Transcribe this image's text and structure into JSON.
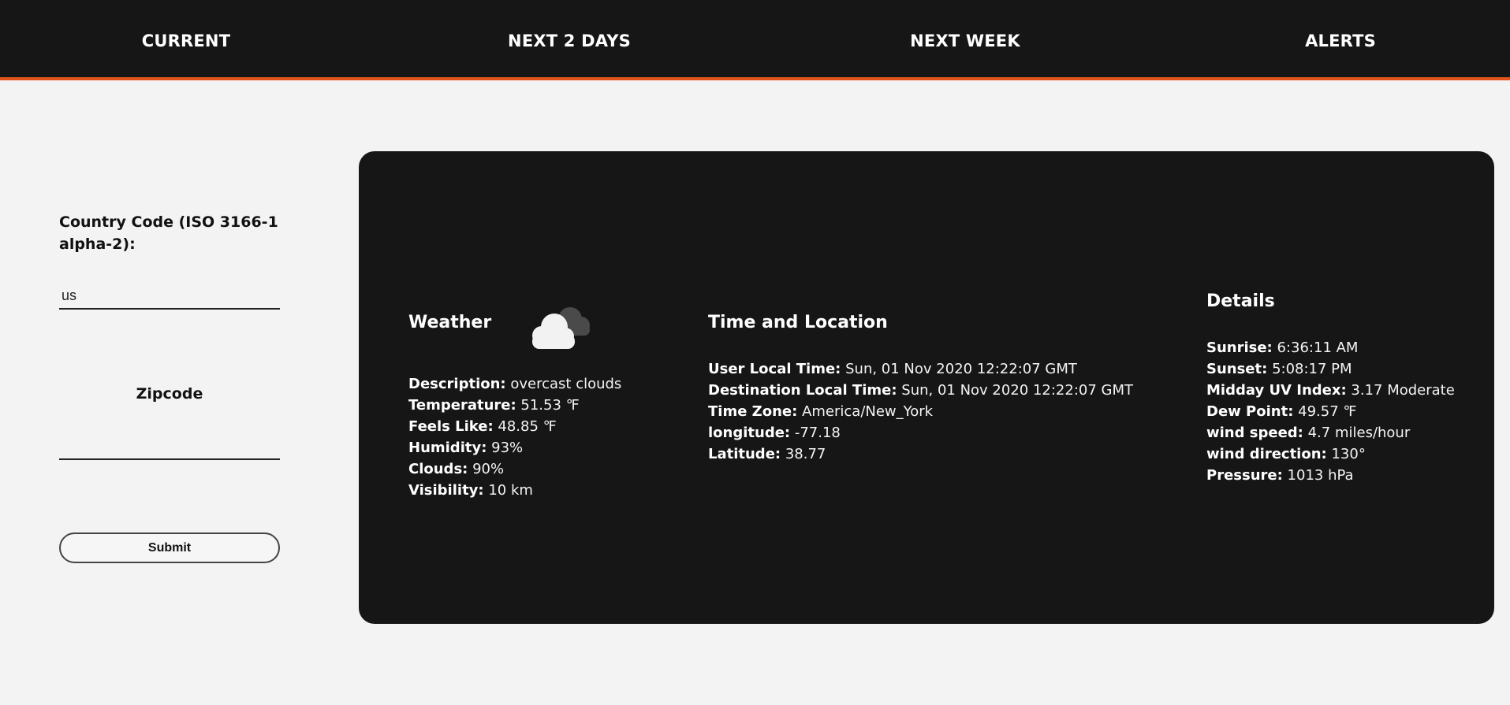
{
  "nav": {
    "tabs": [
      "CURRENT",
      "NEXT 2 DAYS",
      "NEXT WEEK",
      "ALERTS"
    ]
  },
  "colors": {
    "nav_bg": "#161616",
    "accent": "#e2531c",
    "page_bg": "#f3f3f3",
    "card_bg": "#161616"
  },
  "form": {
    "country_label": "Country Code (ISO 3166-1 alpha-2):",
    "country_value": "us",
    "zip_label": "Zipcode",
    "zip_value": "",
    "submit_label": "Submit"
  },
  "weather": {
    "title": "Weather",
    "icon": "overcast-clouds-icon",
    "rows": [
      {
        "label": "Description:",
        "value": "overcast clouds"
      },
      {
        "label": "Temperature:",
        "value": "51.53 ℉"
      },
      {
        "label": "Feels Like:",
        "value": "48.85 ℉"
      },
      {
        "label": "Humidity:",
        "value": "93%"
      },
      {
        "label": "Clouds:",
        "value": "90%"
      },
      {
        "label": "Visibility:",
        "value": "10 km"
      }
    ]
  },
  "time_location": {
    "title": "Time and Location",
    "rows": [
      {
        "label": "User Local Time:",
        "value": "Sun, 01 Nov 2020 12:22:07 GMT"
      },
      {
        "label": "Destination Local Time:",
        "value": "Sun, 01 Nov 2020 12:22:07 GMT"
      },
      {
        "label": "Time Zone:",
        "value": "America/New_York"
      },
      {
        "label": "longitude:",
        "value": "-77.18"
      },
      {
        "label": "Latitude:",
        "value": "38.77"
      }
    ]
  },
  "details": {
    "title": "Details",
    "rows": [
      {
        "label": "Sunrise:",
        "value": "6:36:11 AM"
      },
      {
        "label": "Sunset:",
        "value": "5:08:17 PM"
      },
      {
        "label": "Midday UV Index:",
        "value": "3.17 Moderate"
      },
      {
        "label": "Dew Point:",
        "value": "49.57 ℉"
      },
      {
        "label": "wind speed:",
        "value": "4.7 miles/hour"
      },
      {
        "label": "wind direction:",
        "value": "130°"
      },
      {
        "label": "Pressure:",
        "value": "1013 hPa"
      }
    ]
  }
}
